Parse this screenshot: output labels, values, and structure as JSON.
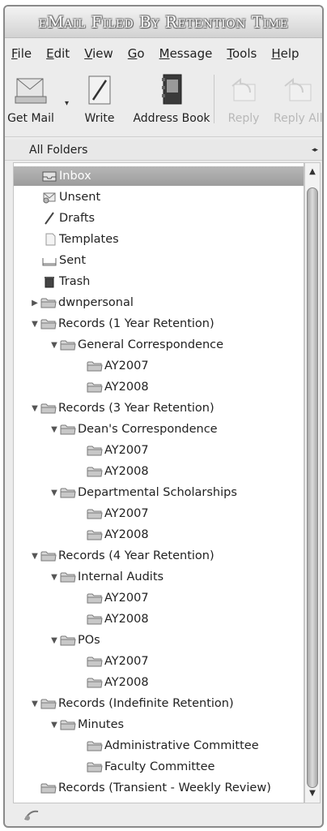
{
  "window": {
    "title": "eMail Filed By Retention Time"
  },
  "menu": [
    {
      "key": "F",
      "rest": "ile"
    },
    {
      "key": "E",
      "rest": "dit"
    },
    {
      "key": "V",
      "rest": "iew"
    },
    {
      "key": "G",
      "rest": "o"
    },
    {
      "key": "M",
      "rest": "essage"
    },
    {
      "key": "T",
      "rest": "ools"
    },
    {
      "key": "H",
      "rest": "elp"
    }
  ],
  "toolbar": {
    "get_mail": "Get Mail",
    "write": "Write",
    "address_book": "Address Book",
    "reply": "Reply",
    "reply_all": "Reply All"
  },
  "folder_pane": {
    "header": "All Folders"
  },
  "folders": {
    "inbox": "Inbox",
    "unsent": "Unsent",
    "drafts": "Drafts",
    "templates": "Templates",
    "sent": "Sent",
    "trash": "Trash",
    "dwnpersonal": "dwnpersonal",
    "r1": "Records (1 Year Retention)",
    "r1_gc": "General Correspondence",
    "r1_gc_2007": "AY2007",
    "r1_gc_2008": "AY2008",
    "r3": "Records (3 Year Retention)",
    "r3_dc": "Dean's Correspondence",
    "r3_dc_2007": "AY2007",
    "r3_dc_2008": "AY2008",
    "r3_ds": "Departmental Scholarships",
    "r3_ds_2007": "AY2007",
    "r3_ds_2008": "AY2008",
    "r4": "Records (4 Year Retention)",
    "r4_ia": "Internal Audits",
    "r4_ia_2007": "AY2007",
    "r4_ia_2008": "AY2008",
    "r4_po": "POs",
    "r4_po_2007": "AY2007",
    "r4_po_2008": "AY2008",
    "ri": "Records (Indefinite Retention)",
    "ri_min": "Minutes",
    "ri_min_admin": "Administrative Committee",
    "ri_min_faculty": "Faculty Committee",
    "rt": "Records (Transient - Weekly Review)"
  }
}
